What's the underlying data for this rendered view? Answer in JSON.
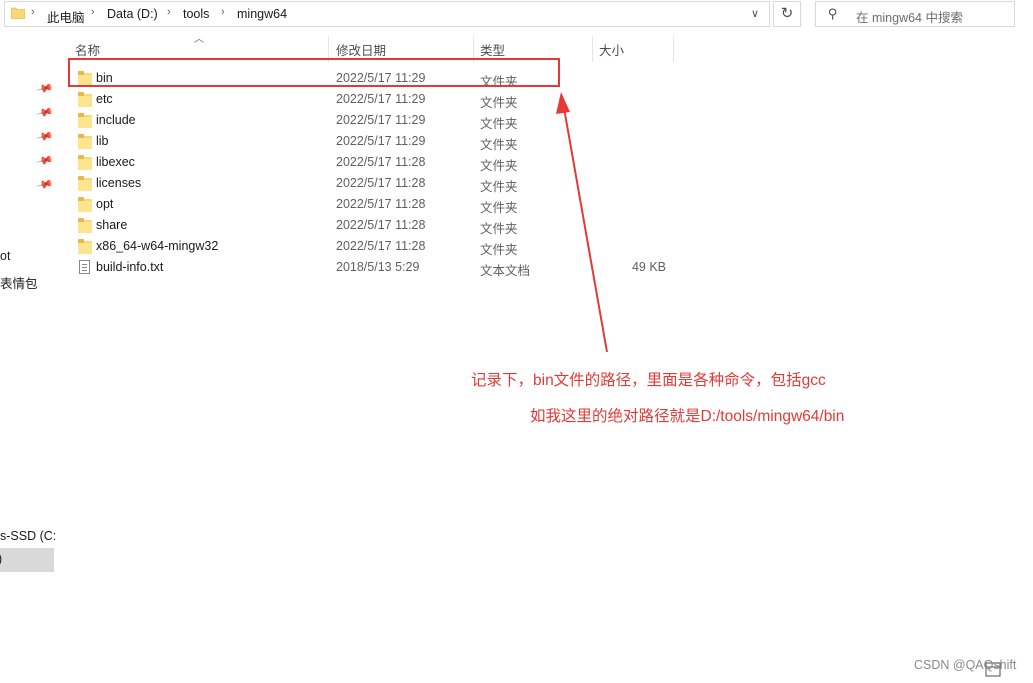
{
  "address": {
    "crumbs": [
      "此电脑",
      "Data (D:)",
      "tools",
      "mingw64"
    ],
    "separator": "›",
    "dropdown": "∨",
    "refresh": "↻"
  },
  "search": {
    "placeholder": "在 mingw64 中搜索"
  },
  "nav": {
    "items": [
      "ot",
      "表情包",
      "s-SSD (C:)"
    ],
    "selected": ")"
  },
  "columns": {
    "name": "名称",
    "date": "修改日期",
    "type": "类型",
    "size": "大小"
  },
  "files": [
    {
      "name": "bin",
      "date": "2022/5/17 11:29",
      "type": "文件夹",
      "size": "",
      "icon": "folder-icon"
    },
    {
      "name": "etc",
      "date": "2022/5/17 11:29",
      "type": "文件夹",
      "size": "",
      "icon": "folder-icon"
    },
    {
      "name": "include",
      "date": "2022/5/17 11:29",
      "type": "文件夹",
      "size": "",
      "icon": "folder-icon"
    },
    {
      "name": "lib",
      "date": "2022/5/17 11:29",
      "type": "文件夹",
      "size": "",
      "icon": "folder-icon"
    },
    {
      "name": "libexec",
      "date": "2022/5/17 11:28",
      "type": "文件夹",
      "size": "",
      "icon": "folder-icon"
    },
    {
      "name": "licenses",
      "date": "2022/5/17 11:28",
      "type": "文件夹",
      "size": "",
      "icon": "folder-icon"
    },
    {
      "name": "opt",
      "date": "2022/5/17 11:28",
      "type": "文件夹",
      "size": "",
      "icon": "folder-icon"
    },
    {
      "name": "share",
      "date": "2022/5/17 11:28",
      "type": "文件夹",
      "size": "",
      "icon": "folder-icon"
    },
    {
      "name": "x86_64-w64-mingw32",
      "date": "2022/5/17 11:28",
      "type": "文件夹",
      "size": "",
      "icon": "folder-icon"
    },
    {
      "name": "build-info.txt",
      "date": "2018/5/13 5:29",
      "type": "文本文档",
      "size": "49 KB",
      "icon": "text-file-icon"
    }
  ],
  "annotation": {
    "line1": "记录下，bin文件的路径，里面是各种命令，包括gcc",
    "line2": "如我这里的绝对路径就是D:/tools/mingw64/bin",
    "color": "#e53935"
  },
  "watermark": "CSDN @QAQshift"
}
